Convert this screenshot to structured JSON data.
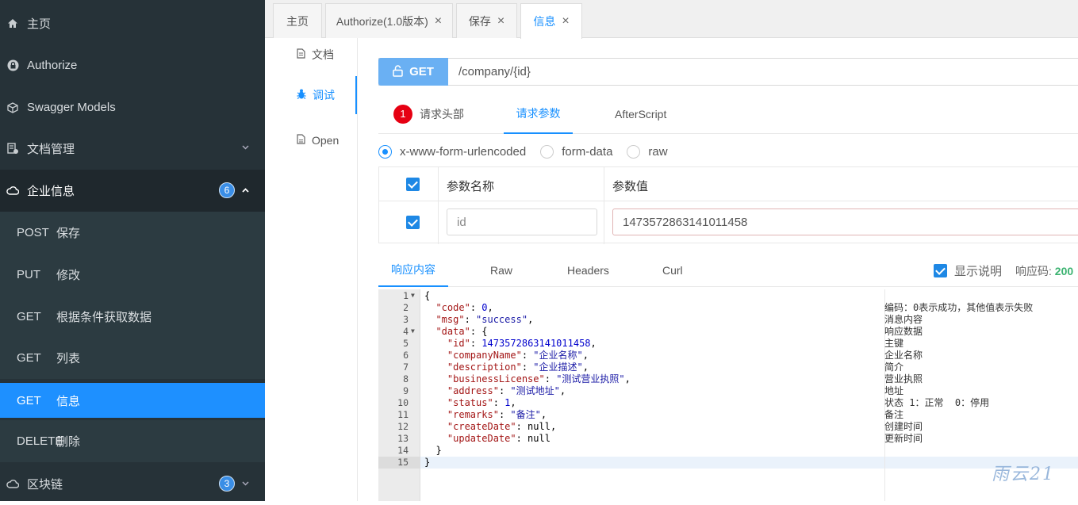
{
  "sidebar": {
    "items": [
      {
        "label": "主页",
        "icon": "home-icon"
      },
      {
        "label": "Authorize",
        "icon": "lock-icon"
      },
      {
        "label": "Swagger Models",
        "icon": "cube-icon"
      },
      {
        "label": "文档管理",
        "icon": "document-manage-icon"
      },
      {
        "label": "企业信息",
        "icon": "cloud-icon",
        "badge": "6"
      },
      {
        "label": "区块链",
        "icon": "cloud-icon",
        "badge": "3"
      }
    ],
    "endpoints": [
      {
        "method": "POST",
        "label": "保存"
      },
      {
        "method": "PUT",
        "label": "修改"
      },
      {
        "method": "GET",
        "label": "根据条件获取数据"
      },
      {
        "method": "GET",
        "label": "列表"
      },
      {
        "method": "GET",
        "label": "信息"
      },
      {
        "method": "DELETE",
        "label": "删除"
      }
    ]
  },
  "tabs": [
    {
      "label": "主页"
    },
    {
      "label": "Authorize(1.0版本)"
    },
    {
      "label": "保存"
    },
    {
      "label": "信息"
    }
  ],
  "inner_nav": [
    {
      "label": "文档"
    },
    {
      "label": "调试"
    },
    {
      "label": "Open"
    }
  ],
  "request": {
    "method": "GET",
    "url": "/company/{id}",
    "tabs": [
      "请求头部",
      "请求参数",
      "AfterScript"
    ],
    "header_badge": "1",
    "content_types": [
      "x-www-form-urlencoded",
      "form-data",
      "raw"
    ],
    "selected_content_type": "x-www-form-urlencoded",
    "params_header": {
      "name": "参数名称",
      "value": "参数值"
    },
    "params": [
      {
        "name": "id",
        "value": "1473572863141011458"
      }
    ]
  },
  "response": {
    "tabs": [
      "响应内容",
      "Raw",
      "Headers",
      "Curl"
    ],
    "show_desc_label": "显示说明",
    "code_label": "响应码:",
    "code_value": "200",
    "line_numbers": [
      "1",
      "2",
      "3",
      "4",
      "5",
      "6",
      "7",
      "8",
      "9",
      "10",
      "11",
      "12",
      "13",
      "14",
      "15"
    ],
    "descriptions": [
      "编码：0表示成功，其他值表示失败",
      "消息内容",
      "响应数据",
      "主键",
      "企业名称",
      "简介",
      "营业执照",
      "地址",
      "状态 1：正常  0：停用",
      "备注",
      "创建时间",
      "更新时间"
    ],
    "json_lines": [
      {
        "t": [
          [
            "pl",
            "{"
          ]
        ]
      },
      {
        "t": [
          [
            "pl",
            "  "
          ],
          [
            "k",
            "\"code\""
          ],
          [
            "pl",
            ": "
          ],
          [
            "n",
            "0"
          ],
          [
            "pl",
            ","
          ]
        ]
      },
      {
        "t": [
          [
            "pl",
            "  "
          ],
          [
            "k",
            "\"msg\""
          ],
          [
            "pl",
            ": "
          ],
          [
            "s",
            "\"success\""
          ],
          [
            "pl",
            ","
          ]
        ]
      },
      {
        "t": [
          [
            "pl",
            "  "
          ],
          [
            "k",
            "\"data\""
          ],
          [
            "pl",
            ": {"
          ]
        ]
      },
      {
        "t": [
          [
            "pl",
            "    "
          ],
          [
            "k",
            "\"id\""
          ],
          [
            "pl",
            ": "
          ],
          [
            "n",
            "1473572863141011458"
          ],
          [
            "pl",
            ","
          ]
        ]
      },
      {
        "t": [
          [
            "pl",
            "    "
          ],
          [
            "k",
            "\"companyName\""
          ],
          [
            "pl",
            ": "
          ],
          [
            "s",
            "\"企业名称\""
          ],
          [
            "pl",
            ","
          ]
        ]
      },
      {
        "t": [
          [
            "pl",
            "    "
          ],
          [
            "k",
            "\"description\""
          ],
          [
            "pl",
            ": "
          ],
          [
            "s",
            "\"企业描述\""
          ],
          [
            "pl",
            ","
          ]
        ]
      },
      {
        "t": [
          [
            "pl",
            "    "
          ],
          [
            "k",
            "\"businessLicense\""
          ],
          [
            "pl",
            ": "
          ],
          [
            "s",
            "\"测试营业执照\""
          ],
          [
            "pl",
            ","
          ]
        ]
      },
      {
        "t": [
          [
            "pl",
            "    "
          ],
          [
            "k",
            "\"address\""
          ],
          [
            "pl",
            ": "
          ],
          [
            "s",
            "\"测试地址\""
          ],
          [
            "pl",
            ","
          ]
        ]
      },
      {
        "t": [
          [
            "pl",
            "    "
          ],
          [
            "k",
            "\"status\""
          ],
          [
            "pl",
            ": "
          ],
          [
            "n",
            "1"
          ],
          [
            "pl",
            ","
          ]
        ]
      },
      {
        "t": [
          [
            "pl",
            "    "
          ],
          [
            "k",
            "\"remarks\""
          ],
          [
            "pl",
            ": "
          ],
          [
            "s",
            "\"备注\""
          ],
          [
            "pl",
            ","
          ]
        ]
      },
      {
        "t": [
          [
            "pl",
            "    "
          ],
          [
            "k",
            "\"createDate\""
          ],
          [
            "pl",
            ": null,"
          ]
        ]
      },
      {
        "t": [
          [
            "pl",
            "    "
          ],
          [
            "k",
            "\"updateDate\""
          ],
          [
            "pl",
            ": null"
          ]
        ]
      },
      {
        "t": [
          [
            "pl",
            "  }"
          ]
        ]
      },
      {
        "t": [
          [
            "pl",
            "}"
          ]
        ]
      }
    ]
  },
  "watermark": "雨云21",
  "colors": {
    "sidebar_bg": "#263238",
    "active_blue": "#1e90ff",
    "accent": "#1890ff",
    "get_button": "#6ab0f3",
    "badge_red": "#e60012",
    "code_green": "#3cb371"
  }
}
